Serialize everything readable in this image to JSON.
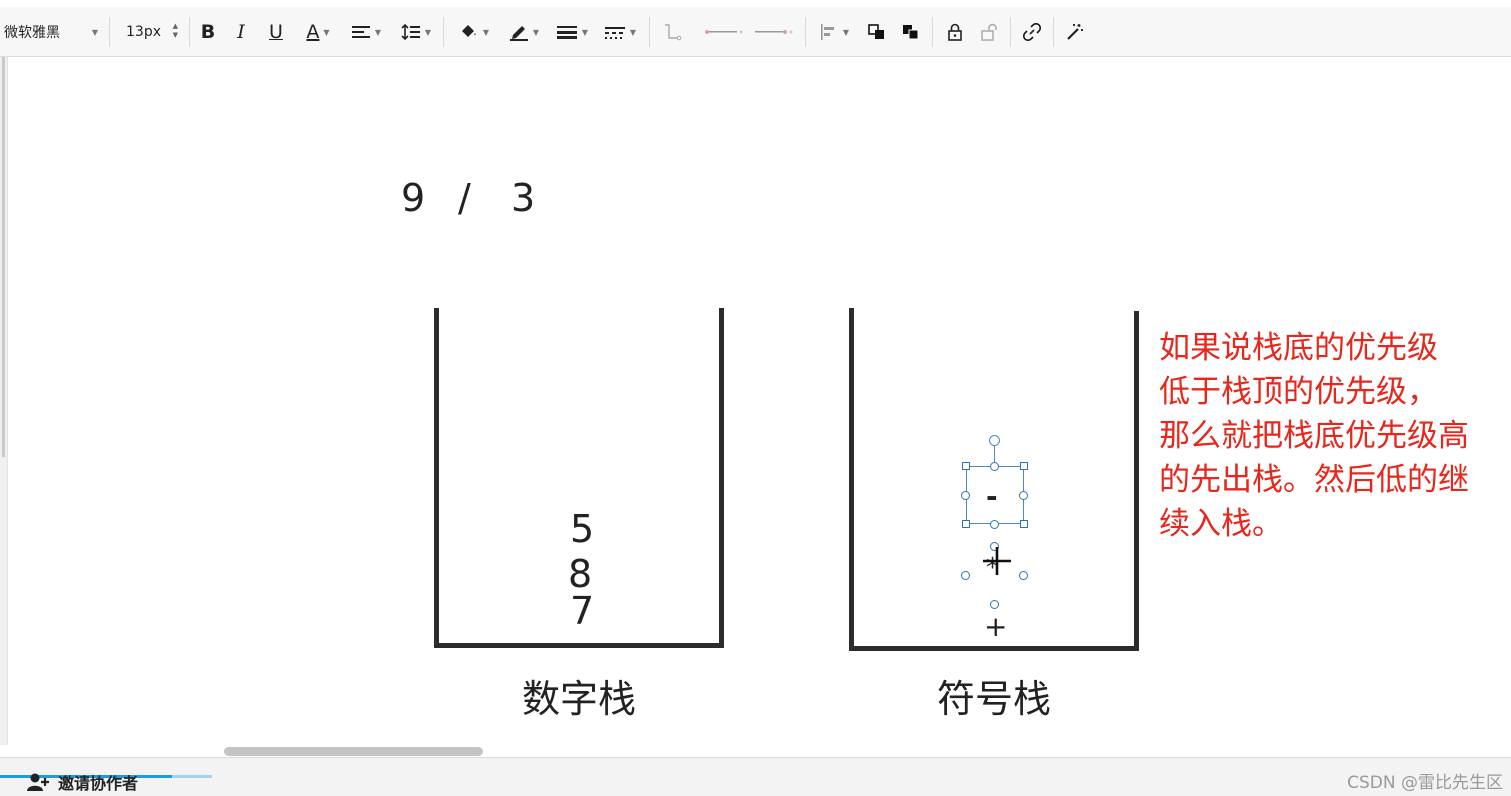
{
  "toolbar": {
    "font_family": "微软雅黑",
    "font_size": "13px",
    "bold_label": "B",
    "italic_label": "I",
    "underline_label": "U",
    "font_color_label": "A"
  },
  "canvas": {
    "expression": {
      "left": "9",
      "operator": "/",
      "right": "3"
    },
    "number_stack": {
      "label": "数字栈",
      "items": [
        "5",
        "8",
        "7"
      ]
    },
    "operator_stack": {
      "label": "符号栈",
      "items": [
        "-",
        "*",
        "+"
      ]
    },
    "note_lines": [
      "如果说栈底的优先级",
      "低于栈顶的优先级，",
      "那么就把栈底优先级高",
      "的先出栈。然后低的继",
      "续入栈。"
    ]
  },
  "footer": {
    "invite_label": "邀请协作者",
    "watermark": "CSDN @雷比先生区"
  },
  "colors": {
    "note_text": "#e8261b",
    "selection": "#4a89c8",
    "progress": "#1e9be0"
  }
}
